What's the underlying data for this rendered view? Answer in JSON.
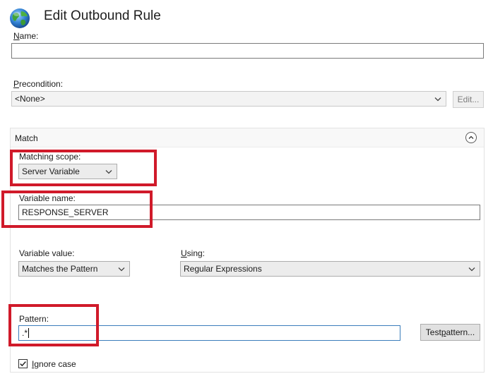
{
  "dialog": {
    "title": "Edit Outbound Rule"
  },
  "name": {
    "label_mnemonic": "N",
    "label_rest": "ame:",
    "value": ""
  },
  "precondition": {
    "label_mnemonic": "P",
    "label_rest": "recondition:",
    "selected": "<None>",
    "edit_button": "Edit..."
  },
  "match": {
    "title": "Match",
    "scope": {
      "label": "Matching scope:",
      "selected": "Server Variable"
    },
    "variable_name": {
      "label": "Variable name:",
      "value": "RESPONSE_SERVER"
    },
    "variable_value": {
      "label": "Variable value:",
      "selected": "Matches the Pattern"
    },
    "using": {
      "label_mnemonic": "U",
      "label_rest": "sing:",
      "selected": "Regular Expressions"
    },
    "pattern": {
      "label": "Pattern:",
      "value": ".*",
      "test_button_prefix": "Test ",
      "test_button_mnemonic": "p",
      "test_button_rest": "attern..."
    },
    "ignore_case": {
      "label_mnemonic": "I",
      "label_rest": "gnore case",
      "checked": true
    }
  },
  "colors": {
    "highlight": "#d01a2a",
    "focus_border": "#3b7dbb"
  },
  "icons": {
    "dialog": "globe-icon",
    "dropdown": "chevron-down-icon",
    "collapse": "chevron-up-icon",
    "checkbox": "checkmark-icon"
  }
}
